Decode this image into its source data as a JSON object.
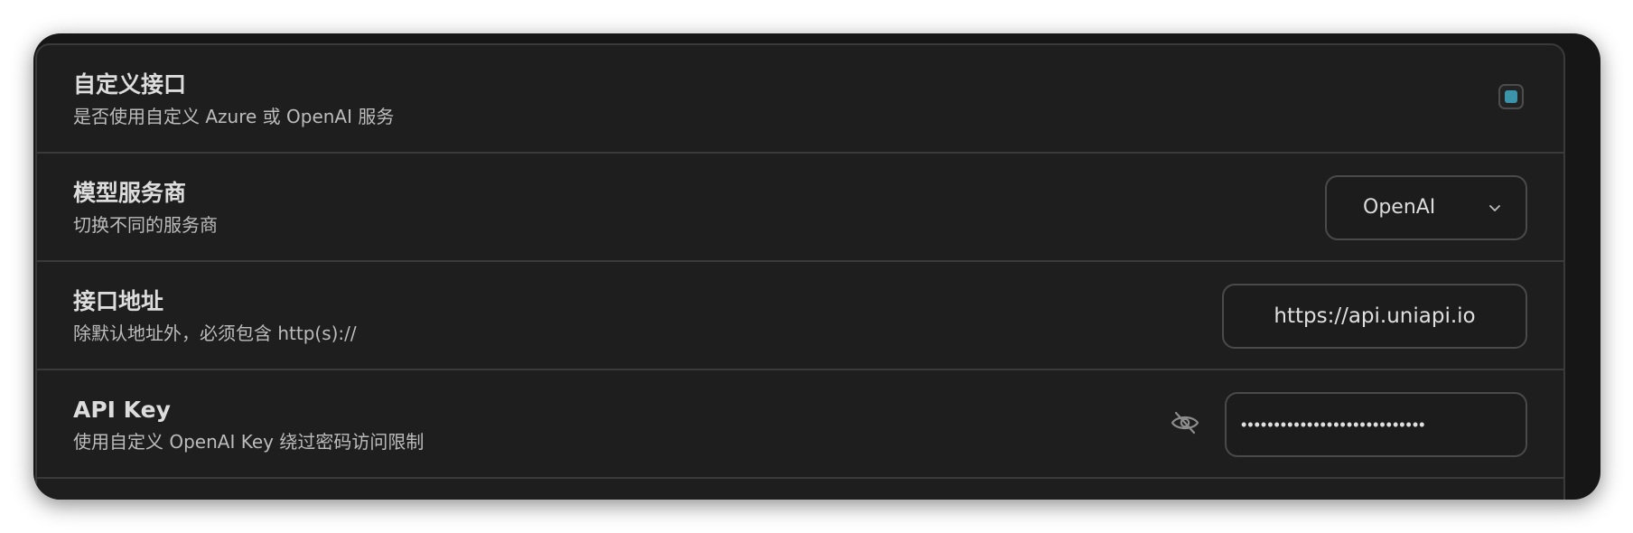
{
  "settings": {
    "rows": [
      {
        "title": "自定义接口",
        "subtitle": "是否使用自定义 Azure 或 OpenAI 服务",
        "control": "checkbox",
        "checked": true
      },
      {
        "title": "模型服务商",
        "subtitle": "切换不同的服务商",
        "control": "select",
        "value": "OpenAI"
      },
      {
        "title": "接口地址",
        "subtitle": "除默认地址外，必须包含 http(s)://",
        "control": "text",
        "value": "https://api.uniapi.io"
      },
      {
        "title": "API Key",
        "subtitle": "使用自定义 OpenAI Key 绕过密码访问限制",
        "control": "password",
        "value": "sk-uniapi-hidden-key-0000000",
        "toggle_icon": "eye-off-icon"
      }
    ]
  },
  "colors": {
    "accent": "#3c94ab",
    "panel_background": "#1e1e1e",
    "border": "#3a3a3a"
  }
}
